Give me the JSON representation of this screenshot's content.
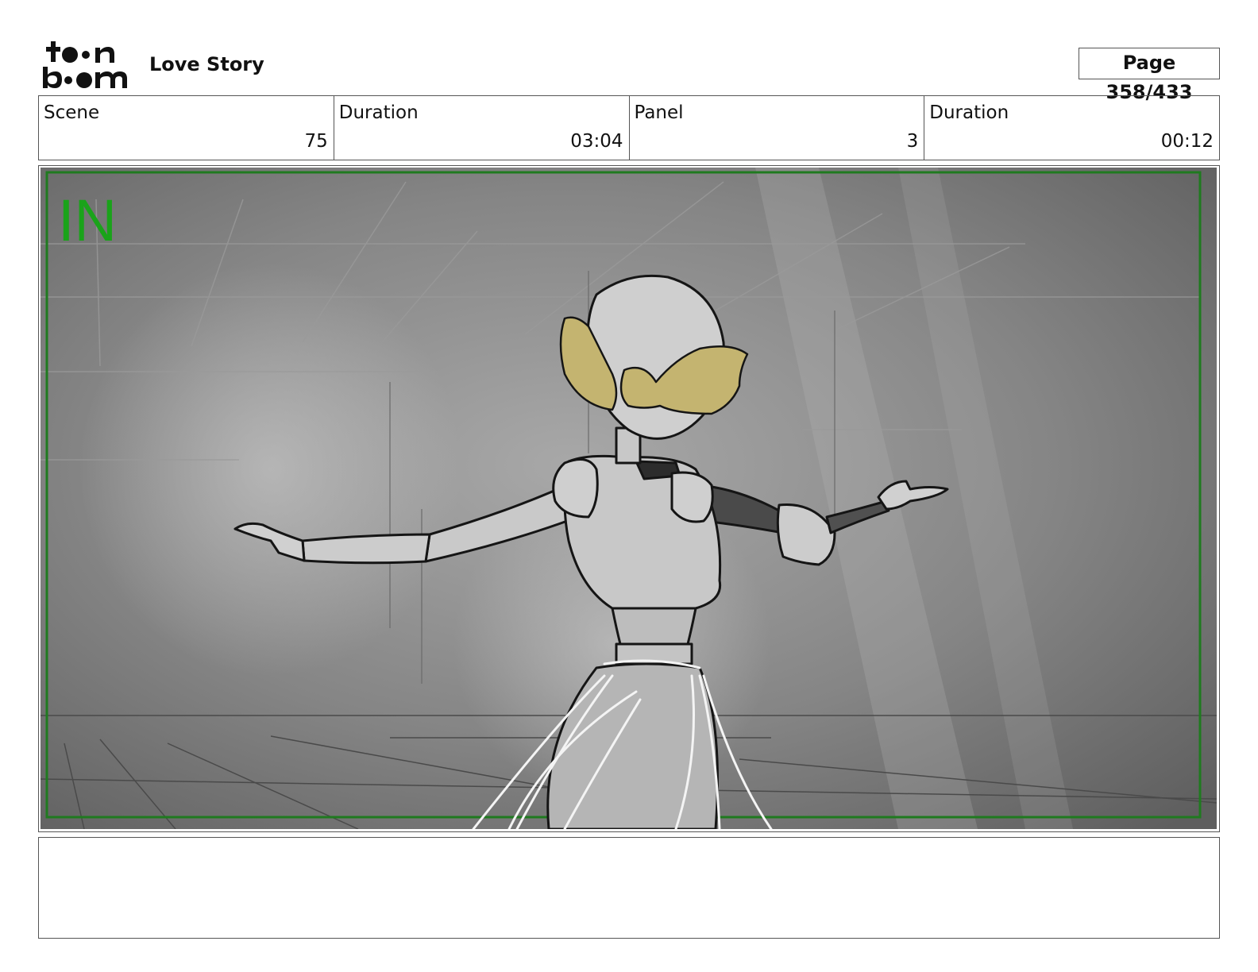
{
  "header": {
    "logo_text": "toonboom",
    "project_title": "Love Story",
    "page_indicator": "Page 358/433"
  },
  "info": [
    {
      "label": "Scene",
      "value": "75"
    },
    {
      "label": "Duration",
      "value": "03:04"
    },
    {
      "label": "Panel",
      "value": "3"
    },
    {
      "label": "Duration",
      "value": "00:12"
    }
  ],
  "panel": {
    "transition_label": "IN",
    "safe_frame_color": "#1f7a1f",
    "label_color": "#1aa31a",
    "hair_color": "#c4b470"
  },
  "notes": {
    "text": ""
  }
}
